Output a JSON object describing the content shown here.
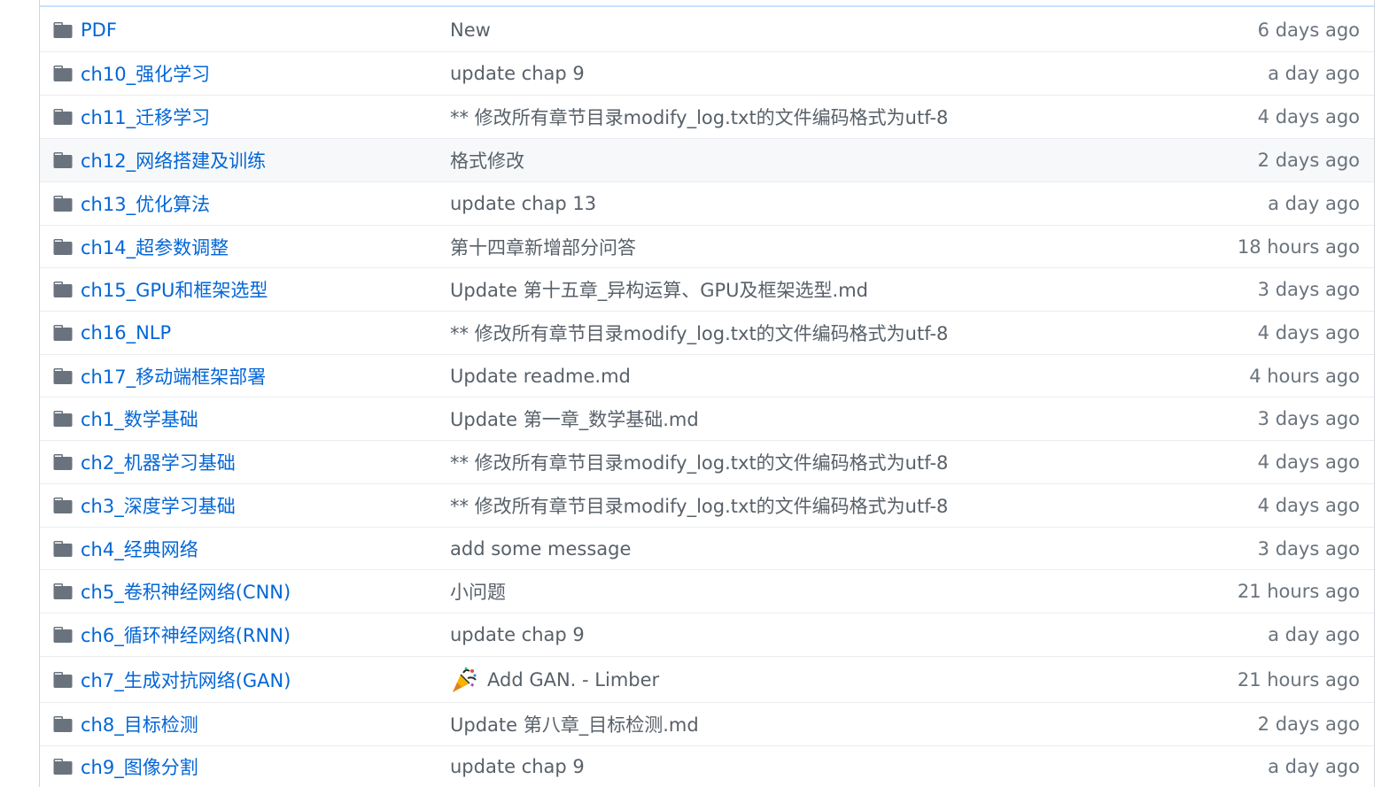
{
  "rows": [
    {
      "name": "PDF",
      "message": "New",
      "age": "6 days ago"
    },
    {
      "name": "ch10_强化学习",
      "message": "update chap 9",
      "age": "a day ago"
    },
    {
      "name": "ch11_迁移学习",
      "message": "** 修改所有章节目录modify_log.txt的文件编码格式为utf-8",
      "age": "4 days ago"
    },
    {
      "name": "ch12_网络搭建及训练",
      "message": "格式修改",
      "age": "2 days ago"
    },
    {
      "name": "ch13_优化算法",
      "message": "update chap 13",
      "age": "a day ago"
    },
    {
      "name": "ch14_超参数调整",
      "message": "第十四章新增部分问答",
      "age": "18 hours ago"
    },
    {
      "name": "ch15_GPU和框架选型",
      "message": "Update 第十五章_异构运算、GPU及框架选型.md",
      "age": "3 days ago"
    },
    {
      "name": "ch16_NLP",
      "message": "** 修改所有章节目录modify_log.txt的文件编码格式为utf-8",
      "age": "4 days ago"
    },
    {
      "name": "ch17_移动端框架部署",
      "message": "Update readme.md",
      "age": "4 hours ago"
    },
    {
      "name": "ch1_数学基础",
      "message": "Update 第一章_数学基础.md",
      "age": "3 days ago"
    },
    {
      "name": "ch2_机器学习基础",
      "message": "** 修改所有章节目录modify_log.txt的文件编码格式为utf-8",
      "age": "4 days ago"
    },
    {
      "name": "ch3_深度学习基础",
      "message": "** 修改所有章节目录modify_log.txt的文件编码格式为utf-8",
      "age": "4 days ago"
    },
    {
      "name": "ch4_经典网络",
      "message": "add some message",
      "age": "3 days ago"
    },
    {
      "name": "ch5_卷积神经网络(CNN)",
      "message": "小问题",
      "age": "21 hours ago"
    },
    {
      "name": "ch6_循环神经网络(RNN)",
      "message": "update chap 9",
      "age": "a day ago"
    },
    {
      "name": "ch7_生成对抗网络(GAN)",
      "message": "Add GAN. - Limber",
      "age": "21 hours ago",
      "emoji": "party-popper-icon"
    },
    {
      "name": "ch8_目标检测",
      "message": "Update 第八章_目标检测.md",
      "age": "2 days ago"
    },
    {
      "name": "ch9_图像分割",
      "message": "update chap 9",
      "age": "a day ago"
    }
  ],
  "colors": {
    "link": "#0366d6",
    "muted": "#586069",
    "folder": "#79b8ff",
    "border": "#eaecef",
    "highlight_row": "#f6f8fa"
  },
  "icons": {
    "folder": "folder-icon"
  }
}
